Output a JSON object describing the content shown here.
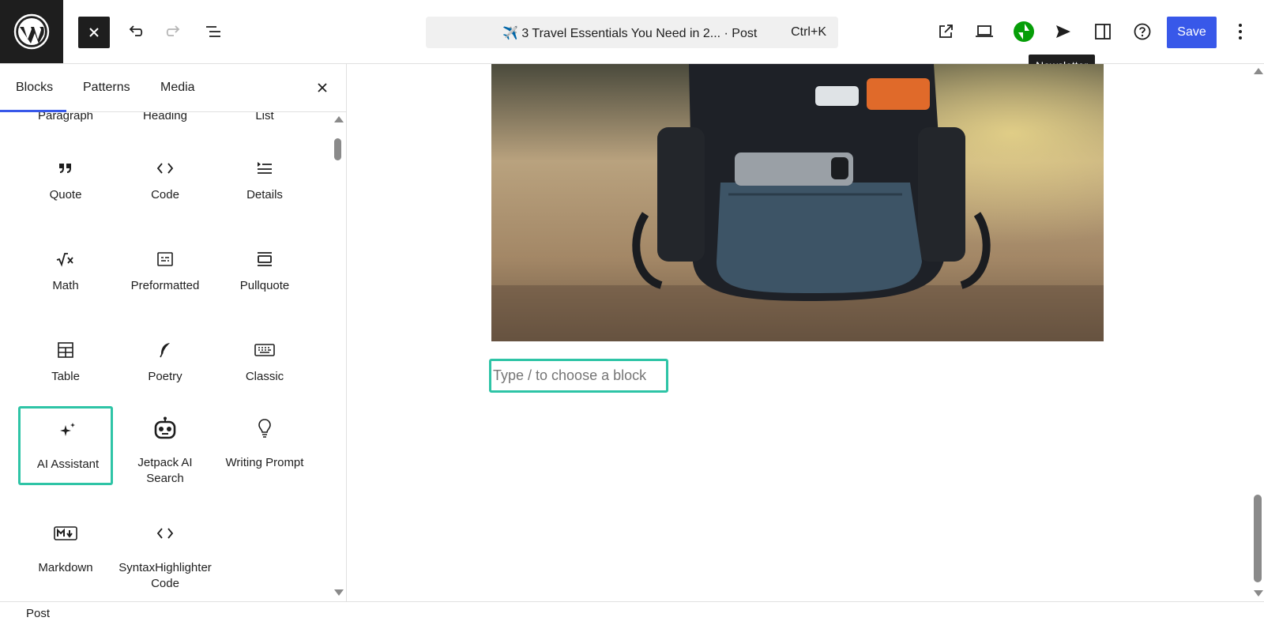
{
  "colors": {
    "accent": "#3858e9",
    "highlight": "#2ec4a6",
    "jetpack": "#069e08",
    "dark": "#1e1e1e"
  },
  "toolbar": {
    "logo_icon": "wordpress-icon",
    "close_icon": "close-icon",
    "undo_icon": "undo-icon",
    "redo_icon": "redo-icon",
    "list_view_icon": "list-view-icon",
    "doc_title": "✈️ 3 Travel Essentials You Need in 2... · Post",
    "doc_shortcut": "Ctrl+K",
    "save_label": "Save",
    "tooltip": "Newsletter"
  },
  "inserter": {
    "tabs": [
      "Blocks",
      "Patterns",
      "Media"
    ],
    "active_tab": "Blocks",
    "partial_row": [
      "Paragraph",
      "Heading",
      "List"
    ],
    "blocks": [
      {
        "label": "Quote",
        "icon": "quote-icon"
      },
      {
        "label": "Code",
        "icon": "code-icon"
      },
      {
        "label": "Details",
        "icon": "details-icon"
      },
      {
        "label": "Math",
        "icon": "math-icon"
      },
      {
        "label": "Preformatted",
        "icon": "preformatted-icon"
      },
      {
        "label": "Pullquote",
        "icon": "pullquote-icon"
      },
      {
        "label": "Table",
        "icon": "table-icon"
      },
      {
        "label": "Poetry",
        "icon": "poetry-icon"
      },
      {
        "label": "Classic",
        "icon": "classic-keyboard-icon"
      },
      {
        "label": "AI Assistant",
        "icon": "sparkles-icon"
      },
      {
        "label": "Jetpack AI Search",
        "icon": "robot-icon"
      },
      {
        "label": "Writing Prompt",
        "icon": "lightbulb-icon"
      },
      {
        "label": "Markdown",
        "icon": "markdown-icon"
      },
      {
        "label": "SyntaxHighlighter Code",
        "icon": "code-icon"
      }
    ]
  },
  "editor": {
    "placeholder": "Type / to choose a block"
  },
  "footer": {
    "breadcrumb": "Post"
  }
}
